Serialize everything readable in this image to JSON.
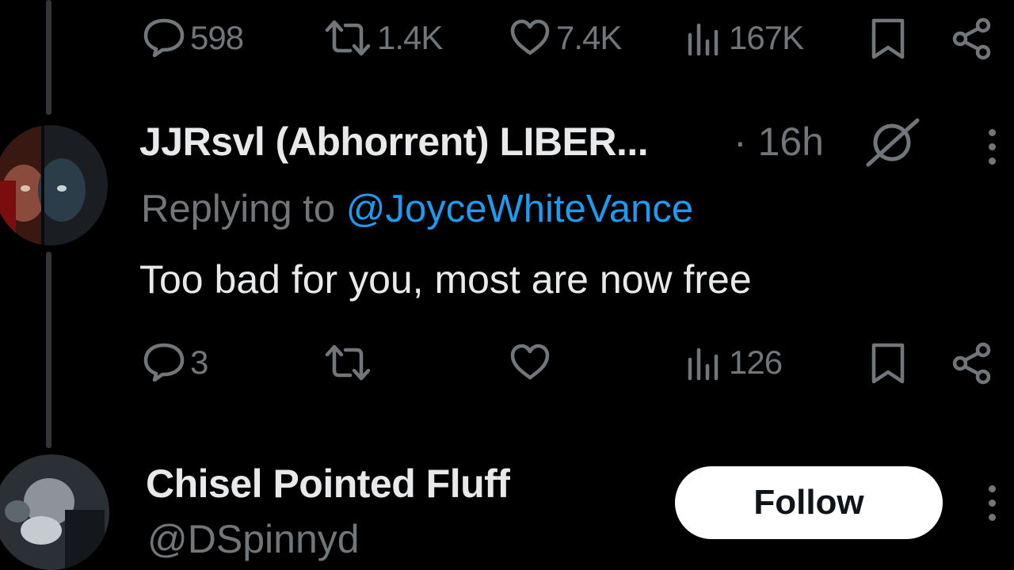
{
  "top_actions": {
    "replies": "598",
    "reposts": "1.4K",
    "likes": "7.4K",
    "views": "167K"
  },
  "reply_tweet": {
    "display_name": "JJRsvl (Abhorrent) LIBER...",
    "separator": "·",
    "time": "16h",
    "replying_to_prefix": "Replying to",
    "replying_to_handle": "@JoyceWhiteVance",
    "text": "Too bad for you, most are now free",
    "actions": {
      "replies": "3",
      "views": "126"
    }
  },
  "suggested_user": {
    "display_name": "Chisel Pointed Fluff",
    "handle": "@DSpinnyd",
    "follow_label": "Follow"
  },
  "icons": {
    "reply": "speech-bubble-icon",
    "repost": "repost-arrows-icon",
    "like": "heart-icon",
    "views": "bar-chart-icon",
    "bookmark": "bookmark-icon",
    "share": "share-nodes-icon",
    "grok": "slashed-circle-icon",
    "more": "vertical-ellipsis-icon"
  },
  "colors": {
    "background": "#000000",
    "text": "#e7e9ea",
    "muted": "#71767b",
    "link": "#1d9bf0",
    "button_bg": "#ffffff"
  }
}
